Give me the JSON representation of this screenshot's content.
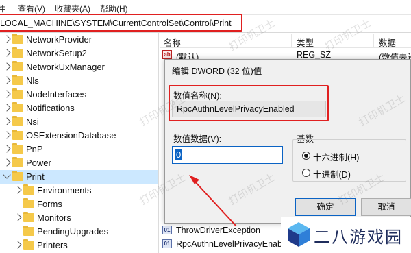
{
  "menu": {
    "items": [
      "查看(V)",
      "收藏夹(A)",
      "帮助(H)"
    ]
  },
  "address": {
    "path": "LOCAL_MACHINE\\SYSTEM\\CurrentControlSet\\Control\\Print"
  },
  "tree": {
    "items": [
      {
        "label": "NetworkProvider"
      },
      {
        "label": "NetworkSetup2"
      },
      {
        "label": "NetworkUxManager"
      },
      {
        "label": "Nls"
      },
      {
        "label": "NodeInterfaces"
      },
      {
        "label": "Notifications"
      },
      {
        "label": "Nsi"
      },
      {
        "label": "OSExtensionDatabase"
      },
      {
        "label": "PnP"
      },
      {
        "label": "Power"
      },
      {
        "label": "Print"
      },
      {
        "label": "Environments"
      },
      {
        "label": "Forms"
      },
      {
        "label": "Monitors"
      },
      {
        "label": "PendingUpgrades"
      },
      {
        "label": "Printers"
      }
    ]
  },
  "list": {
    "columns": {
      "name": "名称",
      "type": "类型",
      "data": "数据"
    },
    "rows": [
      {
        "icon": "ab",
        "name": "(默认)",
        "type": "REG_SZ",
        "data": "(数值未设"
      },
      {
        "icon": "dword",
        "name": "ThrowDriverException",
        "type": "",
        "data": ""
      },
      {
        "icon": "dword",
        "name": "RpcAuthnLevelPrivacyEnab",
        "type": "",
        "data": ""
      }
    ]
  },
  "dialog": {
    "title": "编辑 DWORD (32 位)值",
    "value_name_label": "数值名称(N):",
    "value_name": "RpcAuthnLevelPrivacyEnabled",
    "value_data_label": "数值数据(V):",
    "value_data": "0",
    "base_label": "基数",
    "radix_options": [
      {
        "label": "十六进制(H)",
        "checked": true
      },
      {
        "label": "十进制(D)",
        "checked": false
      }
    ],
    "ok_label": "确定",
    "cancel_label": "取消"
  },
  "watermark": {
    "text": "打印机卫士"
  },
  "brand": {
    "name": "二八游戏园"
  },
  "colors": {
    "highlight_red": "#e02020",
    "accent_blue": "#0b63c4",
    "selection": "#cce8ff"
  }
}
